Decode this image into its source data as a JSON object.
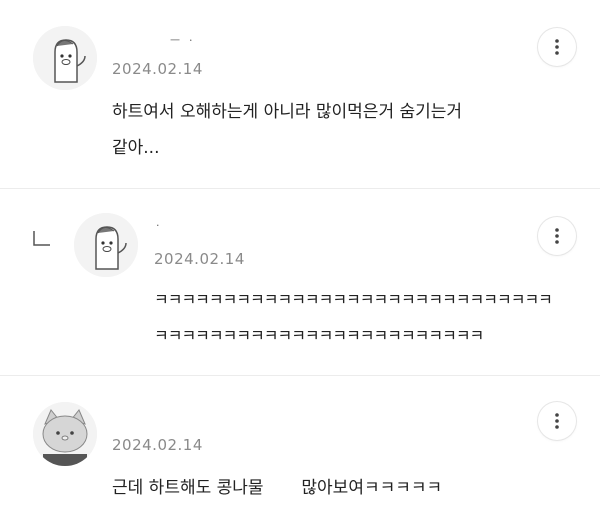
{
  "comments": [
    {
      "author": "ㅡ ㆍ",
      "date": "2024.02.14",
      "text": "하트여서 오해하는게 아니라 많이먹은거 숨기는거\n같아...",
      "is_reply": false
    },
    {
      "author": "·",
      "date": "2024.02.14",
      "text": "ㅋㅋㅋㅋㅋㅋㅋㅋㅋㅋㅋㅋㅋㅋㅋㅋㅋㅋㅋㅋㅋㅋㅋㅋㅋㅋㅋㅋㅋ\nㅋㅋㅋㅋㅋㅋㅋㅋㅋㅋㅋㅋㅋㅋㅋㅋㅋㅋㅋㅋㅋㅋㅋㅋ",
      "is_reply": true
    },
    {
      "author": "",
      "date": "2024.02.14",
      "text": "근데 하트해도 콩나물       많아보여ㅋㅋㅋㅋㅋ",
      "is_reply": false
    }
  ],
  "icons": {
    "more": "more-vertical-icon",
    "reply": "reply-arrow-icon",
    "avatar1": "white-character-avatar",
    "avatar2": "white-character-avatar",
    "avatar3": "gray-cat-avatar"
  }
}
